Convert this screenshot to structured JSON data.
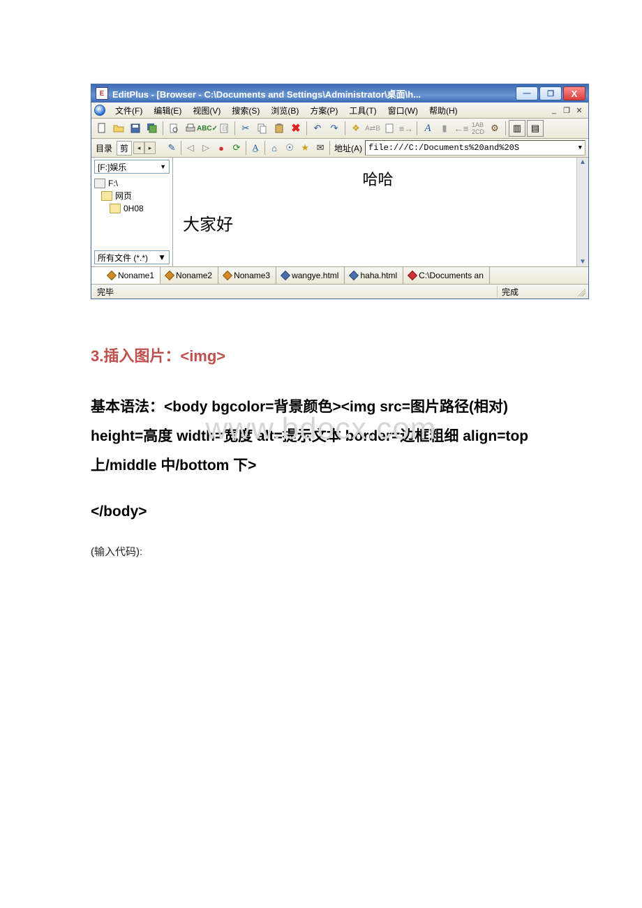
{
  "window": {
    "title": "EditPlus - [Browser - C:\\Documents and Settings\\Administrator\\桌面\\h...",
    "min": "—",
    "max": "❐",
    "close": "X"
  },
  "menu": {
    "file": "文件(F)",
    "edit": "编辑(E)",
    "view": "视图(V)",
    "search": "搜索(S)",
    "browse": "浏览(B)",
    "plan": "方案(P)",
    "tools": "工具(T)",
    "windowm": "窗口(W)",
    "help": "帮助(H)"
  },
  "secondbar": {
    "dir": "目录",
    "clip": "剪",
    "addr_label": "地址(A)",
    "addr_value": "file:///C:/Documents%20and%20S"
  },
  "sidebar": {
    "drive": "[F:]娱乐",
    "root": "F:\\",
    "folder1": "网页",
    "folder2": "0H08",
    "filter": "所有文件 (*.*)"
  },
  "browser": {
    "line1": "哈哈",
    "line2": "大家好"
  },
  "tabs": {
    "t1": "Noname1",
    "t2": "Noname2",
    "t3": "Noname3",
    "t4": "wangye.html",
    "t5": "haha.html",
    "t6": "C:\\Documents an"
  },
  "status": {
    "left": "完毕",
    "right": "完成"
  },
  "doc": {
    "h3": "3.插入图片：<img>",
    "syntax_label": "基本语法：",
    "syntax_body": "<body bgcolor=背景颜色><img src=图片路径(相对)   height=高度  width=宽度  alt=提示文本  border=边框粗细  align=top 上/middle 中/bottom 下>",
    "close": "</body>",
    "input_code": "(输入代码):"
  },
  "watermark": "www.bdocx.com"
}
